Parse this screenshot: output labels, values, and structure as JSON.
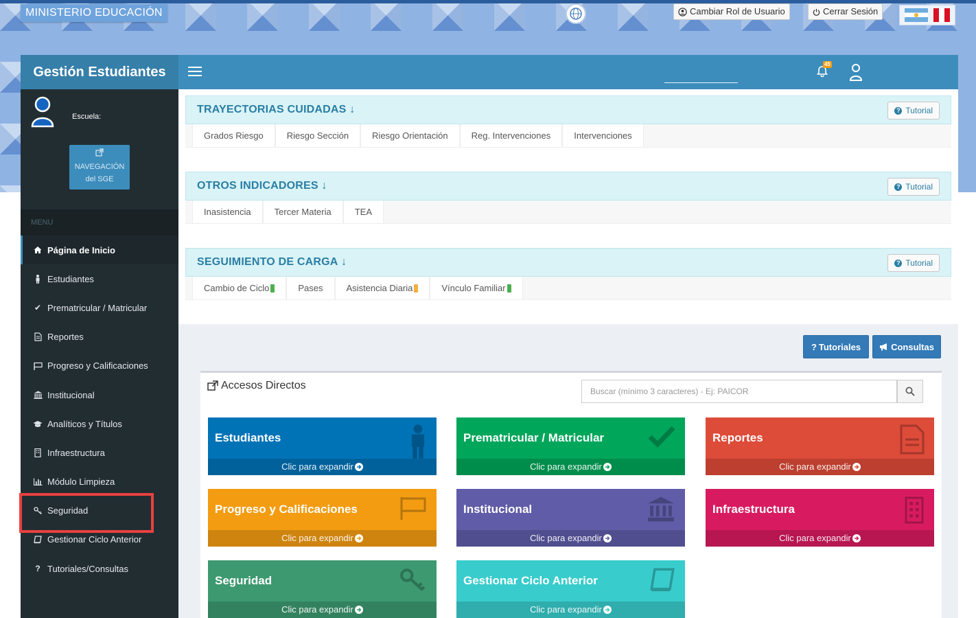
{
  "topbar": {
    "ministry": "MINISTERIO EDUCACIÓN",
    "change_role": "Cambiar Rol de Usuario",
    "logout": "Cerrar Sesión"
  },
  "header": {
    "brand": "Gestión Estudiantes",
    "notification_count": "45"
  },
  "sidebar": {
    "school_label": "Escuela:",
    "sge_button_line1": "NAVEGACIÓN",
    "sge_button_line2": "del SGE",
    "menu_header": "MENU",
    "items": [
      {
        "label": "Página de Inicio",
        "icon": "home-icon"
      },
      {
        "label": "Estudiantes",
        "icon": "student-icon"
      },
      {
        "label": "Prematricular / Matricular",
        "icon": "check-icon"
      },
      {
        "label": "Reportes",
        "icon": "file-icon"
      },
      {
        "label": "Progreso y Calificaciones",
        "icon": "flag-icon"
      },
      {
        "label": "Institucional",
        "icon": "institution-icon"
      },
      {
        "label": "Analíticos y Títulos",
        "icon": "graduation-cap-icon"
      },
      {
        "label": "Infraestructura",
        "icon": "building-icon"
      },
      {
        "label": "Módulo Limpieza",
        "icon": "bar-chart-icon"
      },
      {
        "label": "Seguridad",
        "icon": "key-icon"
      },
      {
        "label": "Gestionar Ciclo Anterior",
        "icon": "book-icon"
      },
      {
        "label": "Tutoriales/Consultas",
        "icon": "question-icon"
      }
    ]
  },
  "panels": [
    {
      "title": "TRAYECTORIAS CUIDADAS",
      "tutorial": "Tutorial",
      "tabs": [
        "Grados Riesgo",
        "Riesgo Sección",
        "Riesgo Orientación",
        "Reg. Intervenciones",
        "Intervenciones"
      ]
    },
    {
      "title": "OTROS INDICADORES",
      "tutorial": "Tutorial",
      "tabs": [
        "Inasistencia",
        "Tercer Materia",
        "TEA"
      ]
    },
    {
      "title": "SEGUIMIENTO DE CARGA",
      "tutorial": "Tutorial",
      "tabs": [
        "Cambio de Ciclo",
        "Pases",
        "Asistencia Diaria",
        "Vínculo Familiar"
      ]
    }
  ],
  "actions": {
    "tutoriales": "Tutoriales",
    "consultas": "Consultas"
  },
  "accesos": {
    "title": "Accesos Directos",
    "search_placeholder": "Buscar (mínimo 3 caracteres) - Ej: PAICOR",
    "expand_label": "Clic para expandir",
    "tiles": [
      {
        "title": "Estudiantes",
        "color": "#0073b7"
      },
      {
        "title": "Prematricular / Matricular",
        "color": "#00a65a"
      },
      {
        "title": "Reportes",
        "color": "#dd4b39"
      },
      {
        "title": "Progreso y Calificaciones",
        "color": "#f39c12"
      },
      {
        "title": "Institucional",
        "color": "#605ca8"
      },
      {
        "title": "Infraestructura",
        "color": "#d81b60"
      },
      {
        "title": "Seguridad",
        "color": "#3d9970"
      },
      {
        "title": "Gestionar Ciclo Anterior",
        "color": "#39cccc"
      }
    ]
  },
  "colors": {
    "sidebar_bg": "#222d32",
    "navbar": "#3c8dbc",
    "brand": "#367fa9",
    "highlight": "#e8413f"
  }
}
